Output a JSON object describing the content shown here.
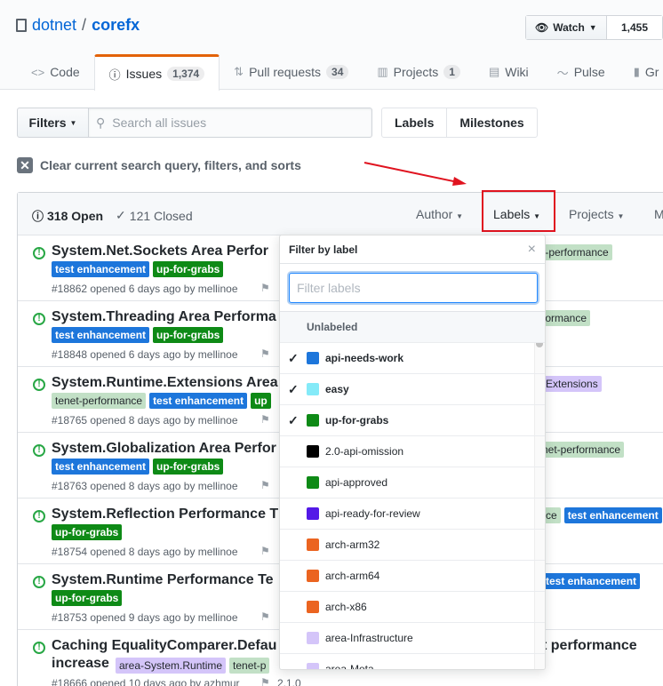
{
  "repo": {
    "owner": "dotnet",
    "separator": "/",
    "name": "corefx"
  },
  "watch": {
    "label": "Watch",
    "count": "1,455"
  },
  "tabs": [
    {
      "label": "Code",
      "count": ""
    },
    {
      "label": "Issues",
      "count": "1,374"
    },
    {
      "label": "Pull requests",
      "count": "34"
    },
    {
      "label": "Projects",
      "count": "1"
    },
    {
      "label": "Wiki",
      "count": ""
    },
    {
      "label": "Pulse",
      "count": ""
    },
    {
      "label": "Gr",
      "count": ""
    }
  ],
  "filters": {
    "button": "Filters",
    "search_placeholder": "Search all issues"
  },
  "labels_button": "Labels",
  "milestones_button": "Milestones",
  "clear_text": "Clear current search query, filters, and sorts",
  "list_header": {
    "open": "318 Open",
    "closed": "121 Closed",
    "author": "Author",
    "labels": "Labels",
    "projects": "Projects",
    "more": "M"
  },
  "issues": [
    {
      "title": "System.Net.Sockets Area Perfor",
      "labels": [
        "test enhancement",
        "up-for-grabs"
      ],
      "meta": "#18862 opened 6 days ago by mellinoe",
      "right": "t-performance"
    },
    {
      "title": "System.Threading Area Performa",
      "labels": [
        "test enhancement",
        "up-for-grabs"
      ],
      "meta": "#18848 opened 6 days ago by mellinoe",
      "right": "formance"
    },
    {
      "title": "System.Runtime.Extensions Area",
      "labels": [
        "tenet-performance",
        "test enhancement",
        "up"
      ],
      "meta": "#18765 opened 8 days ago by mellinoe",
      "right": "Extensions"
    },
    {
      "title": "System.Globalization Area Perfor",
      "labels": [
        "test enhancement",
        "up-for-grabs"
      ],
      "meta": "#18763 opened 8 days ago by mellinoe",
      "right": "net-performance"
    },
    {
      "title": "System.Reflection Performance T",
      "labels": [
        "up-for-grabs"
      ],
      "meta": "#18754 opened 8 days ago by mellinoe",
      "right": "ce",
      "right2": "test enhancement"
    },
    {
      "title": "System.Runtime Performance Te",
      "labels": [
        "up-for-grabs"
      ],
      "meta": "#18753 opened 9 days ago by mellinoe",
      "right": "test enhancement"
    },
    {
      "title": "Caching EqualityComparer.Defau",
      "title2": "increase",
      "labels": [
        "area-System.Runtime",
        "tenet-p"
      ],
      "meta": "#18666 opened 10 days ago by azhmur",
      "milestone": "2.1.0",
      "right": "t performance"
    }
  ],
  "dropdown": {
    "title": "Filter by label",
    "close": "×",
    "filter_placeholder": "Filter labels",
    "unlabeled": "Unlabeled",
    "items": [
      {
        "name": "api-needs-work",
        "color": "#1d76db",
        "selected": true
      },
      {
        "name": "easy",
        "color": "#84eaf8",
        "selected": true
      },
      {
        "name": "up-for-grabs",
        "color": "#0e8a16",
        "selected": true
      },
      {
        "name": "2.0-api-omission",
        "color": "#000000",
        "selected": false
      },
      {
        "name": "api-approved",
        "color": "#0e8a16",
        "selected": false
      },
      {
        "name": "api-ready-for-review",
        "color": "#5319e7",
        "selected": false
      },
      {
        "name": "arch-arm32",
        "color": "#eb6420",
        "selected": false
      },
      {
        "name": "arch-arm64",
        "color": "#eb6420",
        "selected": false
      },
      {
        "name": "arch-x86",
        "color": "#eb6420",
        "selected": false
      },
      {
        "name": "area-Infrastructure",
        "color": "#d4c5f9",
        "selected": false
      },
      {
        "name": "area-Meta",
        "color": "#d4c5f9",
        "selected": false
      }
    ]
  }
}
